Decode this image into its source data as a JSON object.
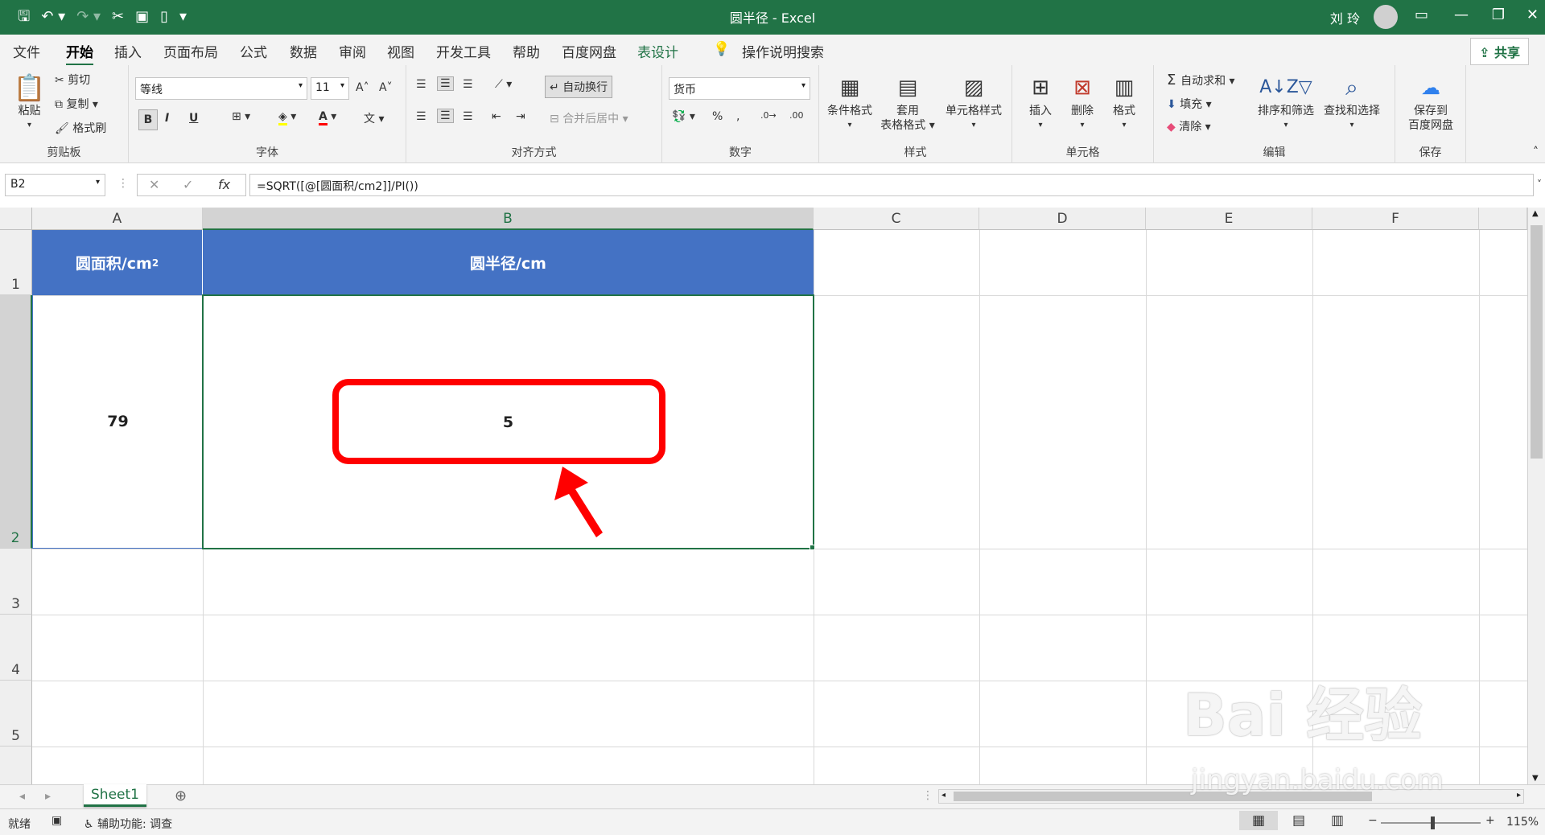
{
  "window": {
    "doc_title": "圆半径  -  Excel",
    "user_name": "刘 玲"
  },
  "tabs": [
    "文件",
    "开始",
    "插入",
    "页面布局",
    "公式",
    "数据",
    "审阅",
    "视图",
    "开发工具",
    "帮助",
    "百度网盘",
    "表设计"
  ],
  "active_tab": "开始",
  "tell_me": "操作说明搜索",
  "share_label": "共享",
  "ribbon": {
    "clipboard": {
      "paste": "粘贴",
      "cut": "剪切",
      "copy": "复制",
      "format_painter": "格式刷",
      "label": "剪贴板"
    },
    "font": {
      "name": "等线",
      "size": "11",
      "bold": "B",
      "italic": "I",
      "underline": "U",
      "label": "字体"
    },
    "alignment": {
      "wrap": "自动换行",
      "merge": "合并后居中",
      "label": "对齐方式"
    },
    "number": {
      "format": "货币",
      "percent": "%",
      "label": "数字"
    },
    "styles": {
      "conditional": "条件格式",
      "table_line1": "套用",
      "table_line2": "表格格式",
      "cell_styles": "单元格样式",
      "label": "样式"
    },
    "cells": {
      "insert": "插入",
      "delete": "删除",
      "format": "格式",
      "label": "单元格"
    },
    "editing": {
      "autosum": "自动求和",
      "fill": "填充",
      "clear": "清除",
      "sort": "排序和筛选",
      "find": "查找和选择",
      "label": "编辑"
    },
    "save": {
      "line1": "保存到",
      "line2": "百度网盘",
      "label": "保存"
    }
  },
  "formula_bar": {
    "name_box": "B2",
    "formula": "=SQRT([@[圆面积/cm2]]/PI())"
  },
  "columns": [
    "A",
    "B",
    "C",
    "D",
    "E",
    "F"
  ],
  "rows": [
    "1",
    "2",
    "3",
    "4",
    "5"
  ],
  "table": {
    "header_a": "圆面积/cm",
    "header_a_sup": "2",
    "header_b": "圆半径/cm",
    "a2": "79",
    "b2": "5"
  },
  "sheet_tab": "Sheet1",
  "status": {
    "ready": "就绪",
    "accessibility": "辅助功能: 调查",
    "zoom": "115%"
  },
  "watermark": {
    "main": "Bai 经验",
    "sub": "jingyan.baidu.com"
  },
  "colors": {
    "excel_green": "#217346",
    "table_header": "#4472c4",
    "highlight": "#ff0000"
  }
}
